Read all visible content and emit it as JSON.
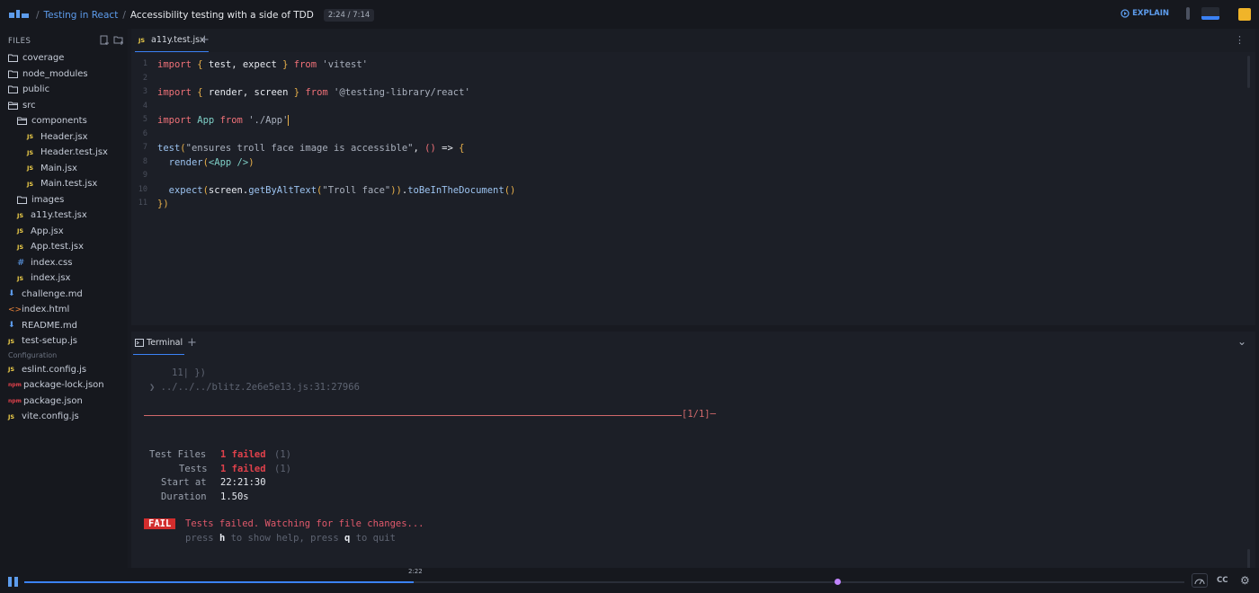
{
  "topbar": {
    "breadcrumb_course": "Testing in React",
    "breadcrumb_lesson": "Accessibility testing with a side of TDD",
    "time": "2:24 / 7:14",
    "explain_label": "EXPLAIN"
  },
  "sidebar": {
    "header": "FILES",
    "items": [
      {
        "label": "coverage",
        "kind": "folder",
        "depth": 0
      },
      {
        "label": "node_modules",
        "kind": "folder",
        "depth": 0
      },
      {
        "label": "public",
        "kind": "folder",
        "depth": 0
      },
      {
        "label": "src",
        "kind": "folder-open",
        "depth": 0
      },
      {
        "label": "components",
        "kind": "folder-open",
        "depth": 1
      },
      {
        "label": "Header.jsx",
        "kind": "js",
        "depth": 2
      },
      {
        "label": "Header.test.jsx",
        "kind": "js",
        "depth": 2
      },
      {
        "label": "Main.jsx",
        "kind": "js",
        "depth": 2
      },
      {
        "label": "Main.test.jsx",
        "kind": "js",
        "depth": 2
      },
      {
        "label": "images",
        "kind": "folder",
        "depth": 1
      },
      {
        "label": "a11y.test.jsx",
        "kind": "js",
        "depth": 1
      },
      {
        "label": "App.jsx",
        "kind": "js",
        "depth": 1
      },
      {
        "label": "App.test.jsx",
        "kind": "js",
        "depth": 1
      },
      {
        "label": "index.css",
        "kind": "css",
        "depth": 1
      },
      {
        "label": "index.jsx",
        "kind": "js",
        "depth": 1
      },
      {
        "label": "challenge.md",
        "kind": "md",
        "depth": 0
      },
      {
        "label": "index.html",
        "kind": "html",
        "depth": 0
      },
      {
        "label": "README.md",
        "kind": "md",
        "depth": 0
      },
      {
        "label": "test-setup.js",
        "kind": "js",
        "depth": 0
      }
    ],
    "config_header": "Configuration",
    "config_items": [
      {
        "label": "eslint.config.js",
        "kind": "js"
      },
      {
        "label": "package-lock.json",
        "kind": "npm"
      },
      {
        "label": "package.json",
        "kind": "npm"
      },
      {
        "label": "vite.config.js",
        "kind": "js"
      }
    ]
  },
  "editor": {
    "tab": "a11y.test.jsx",
    "tab_badge": "JS",
    "line_numbers": [
      "1",
      "2",
      "3",
      "4",
      "5",
      "6",
      "7",
      "8",
      "9",
      "10",
      "11"
    ]
  },
  "terminal": {
    "tab": "Terminal",
    "trace_line": "11| })",
    "trace_path": "❯ ../../../blitz.2e6e5e13.js:31:27966",
    "page_indicator": "[1/1]─",
    "test_files_label": "Test Files",
    "test_files_value": "1 failed",
    "test_files_count": "(1)",
    "tests_label": "Tests",
    "tests_value": "1 failed",
    "tests_count": "(1)",
    "start_label": "Start at",
    "start_value": "22:21:30",
    "duration_label": "Duration",
    "duration_value": "1.50s",
    "fail_badge": "FAIL",
    "fail_message": "Tests failed. Watching for file changes...",
    "help_press1": "press",
    "help_key_h": "h",
    "help_mid": "to show help, press",
    "help_key_q": "q",
    "help_end": "to quit"
  },
  "player": {
    "hover_time": "2:22",
    "progress": 0.336,
    "marker": 0.701,
    "cc_label": "CC"
  },
  "colors": {
    "accent": "#3b82f6",
    "fail": "#d22d2d",
    "keyword": "#f07178",
    "marker": "#c084fc"
  }
}
